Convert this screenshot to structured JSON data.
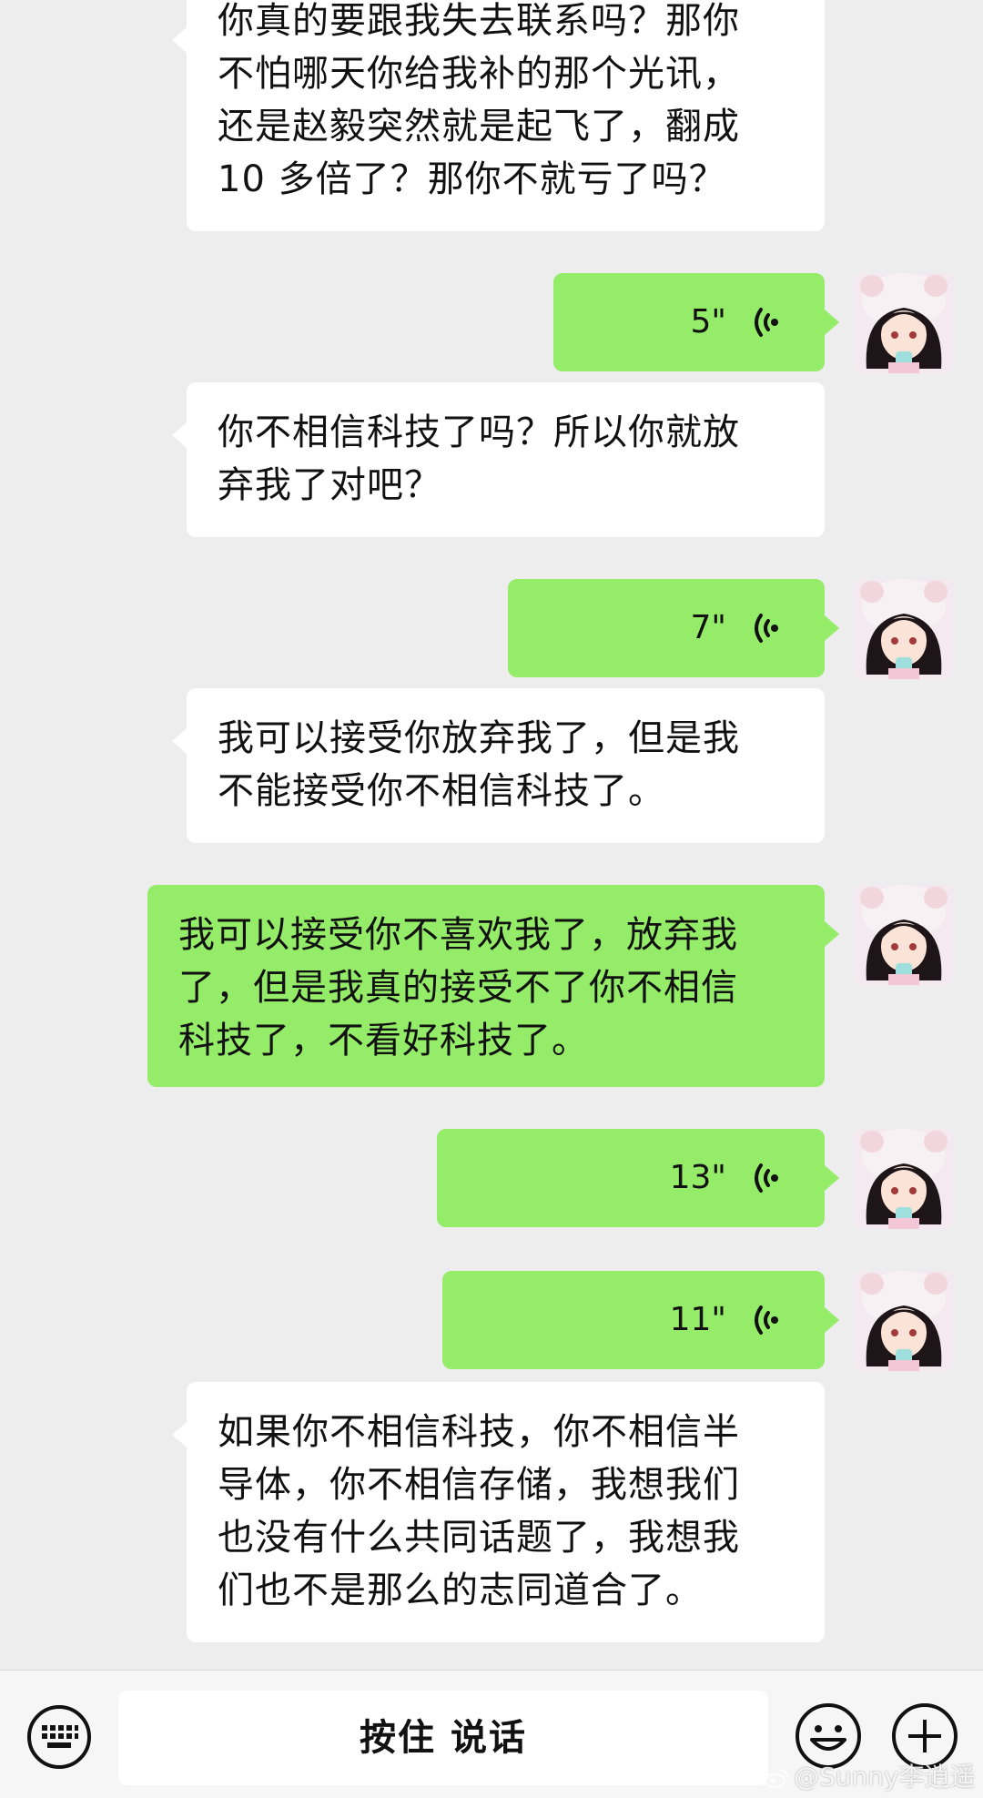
{
  "conversation": {
    "messages": [
      {
        "type": "text",
        "sender": "other",
        "lines": [
          "你真的要跟我失去联系吗？那你",
          "不怕哪天你给我补的那个光讯，",
          "还是赵毅突然就是起飞了，翻成",
          "10 多倍了？那你不就亏了吗？"
        ]
      },
      {
        "type": "voice",
        "sender": "me",
        "duration": "5\""
      },
      {
        "type": "text",
        "sender": "other",
        "lines": [
          "你不相信科技了吗？所以你就放",
          "弃我了对吧？"
        ]
      },
      {
        "type": "voice",
        "sender": "me",
        "duration": "7\""
      },
      {
        "type": "text",
        "sender": "other",
        "lines": [
          "我可以接受你放弃我了，但是我",
          "不能接受你不相信科技了。"
        ]
      },
      {
        "type": "text",
        "sender": "me",
        "lines": [
          "我可以接受你不喜欢我了，放弃我",
          "了，但是我真的接受不了你不相信",
          "科技了，不看好科技了。"
        ]
      },
      {
        "type": "voice",
        "sender": "me",
        "duration": "13\""
      },
      {
        "type": "voice",
        "sender": "me",
        "duration": "11\""
      },
      {
        "type": "text",
        "sender": "other",
        "lines": [
          "如果你不相信科技，你不相信半",
          "导体，你不相信存储，我想我们",
          "也没有什么共同话题了，我想我",
          "们也不是那么的志同道合了。"
        ]
      }
    ]
  },
  "input_bar": {
    "keyboard_icon": "keyboard-icon",
    "hold_to_talk_label": "按住 说话",
    "emoji_icon": "emoji-icon",
    "plus_icon": "plus-icon"
  },
  "watermark": {
    "text": "@Sunny李逍遥",
    "logo": "weibo-logo"
  },
  "colors": {
    "background": "#ededed",
    "outgoing_bubble": "#95ec69",
    "incoming_bubble": "#ffffff",
    "input_bar": "#f6f6f6"
  }
}
